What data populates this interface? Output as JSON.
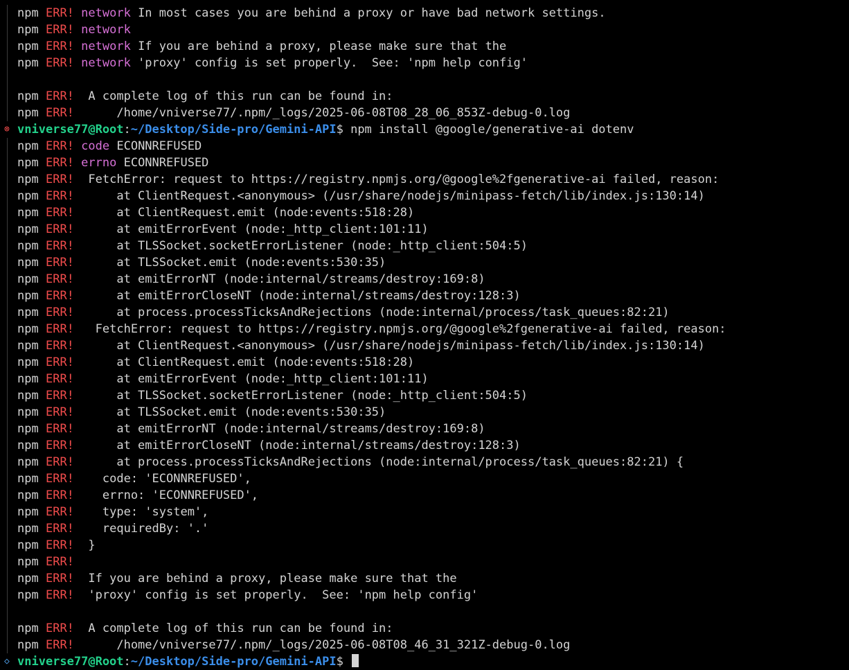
{
  "terminal": {
    "npm": "npm",
    "err": "ERR!",
    "prompt": {
      "user": "vniverse77@Root",
      "colon": ":",
      "path": "~/Desktop/Side-pro/Gemini-API",
      "symbol": "$ "
    },
    "lines": [
      {
        "type": "err",
        "kw": "network",
        "text": " In most cases you are behind a proxy or have bad network settings."
      },
      {
        "type": "err",
        "kw": "network",
        "text": ""
      },
      {
        "type": "err",
        "kw": "network",
        "text": " If you are behind a proxy, please make sure that the"
      },
      {
        "type": "err",
        "kw": "network",
        "text": " 'proxy' config is set properly.  See: 'npm help config'"
      },
      {
        "type": "blank"
      },
      {
        "type": "err",
        "text": " A complete log of this run can be found in:"
      },
      {
        "type": "err",
        "text": "     /home/vniverse77/.npm/_logs/2025-06-08T08_28_06_853Z-debug-0.log"
      },
      {
        "type": "prompt",
        "icon": "fail",
        "command": "npm install @google/generative-ai dotenv"
      },
      {
        "type": "err",
        "kw": "code",
        "text": " ECONNREFUSED"
      },
      {
        "type": "err",
        "kw": "errno",
        "text": " ECONNREFUSED"
      },
      {
        "type": "err",
        "text": " FetchError: request to https://registry.npmjs.org/@google%2fgenerative-ai failed, reason:"
      },
      {
        "type": "err",
        "text": "     at ClientRequest.<anonymous> (/usr/share/nodejs/minipass-fetch/lib/index.js:130:14)"
      },
      {
        "type": "err",
        "text": "     at ClientRequest.emit (node:events:518:28)"
      },
      {
        "type": "err",
        "text": "     at emitErrorEvent (node:_http_client:101:11)"
      },
      {
        "type": "err",
        "text": "     at TLSSocket.socketErrorListener (node:_http_client:504:5)"
      },
      {
        "type": "err",
        "text": "     at TLSSocket.emit (node:events:530:35)"
      },
      {
        "type": "err",
        "text": "     at emitErrorNT (node:internal/streams/destroy:169:8)"
      },
      {
        "type": "err",
        "text": "     at emitErrorCloseNT (node:internal/streams/destroy:128:3)"
      },
      {
        "type": "err",
        "text": "     at process.processTicksAndRejections (node:internal/process/task_queues:82:21)"
      },
      {
        "type": "err",
        "text": "  FetchError: request to https://registry.npmjs.org/@google%2fgenerative-ai failed, reason:"
      },
      {
        "type": "err",
        "text": "     at ClientRequest.<anonymous> (/usr/share/nodejs/minipass-fetch/lib/index.js:130:14)"
      },
      {
        "type": "err",
        "text": "     at ClientRequest.emit (node:events:518:28)"
      },
      {
        "type": "err",
        "text": "     at emitErrorEvent (node:_http_client:101:11)"
      },
      {
        "type": "err",
        "text": "     at TLSSocket.socketErrorListener (node:_http_client:504:5)"
      },
      {
        "type": "err",
        "text": "     at TLSSocket.emit (node:events:530:35)"
      },
      {
        "type": "err",
        "text": "     at emitErrorNT (node:internal/streams/destroy:169:8)"
      },
      {
        "type": "err",
        "text": "     at emitErrorCloseNT (node:internal/streams/destroy:128:3)"
      },
      {
        "type": "err",
        "text": "     at process.processTicksAndRejections (node:internal/process/task_queues:82:21) {"
      },
      {
        "type": "err",
        "text": "   code: 'ECONNREFUSED',"
      },
      {
        "type": "err",
        "text": "   errno: 'ECONNREFUSED',"
      },
      {
        "type": "err",
        "text": "   type: 'system',"
      },
      {
        "type": "err",
        "text": "   requiredBy: '.'"
      },
      {
        "type": "err",
        "text": " }"
      },
      {
        "type": "err",
        "text": ""
      },
      {
        "type": "err",
        "text": " If you are behind a proxy, please make sure that the"
      },
      {
        "type": "err",
        "text": " 'proxy' config is set properly.  See: 'npm help config'"
      },
      {
        "type": "blank"
      },
      {
        "type": "err",
        "text": " A complete log of this run can be found in:"
      },
      {
        "type": "err",
        "text": "     /home/vniverse77/.npm/_logs/2025-06-08T08_46_31_321Z-debug-0.log"
      },
      {
        "type": "prompt",
        "icon": "mark",
        "command": "",
        "cursor": true
      }
    ]
  },
  "icons": {
    "fail": "⊗",
    "mark": "◇"
  },
  "colors": {
    "background": "#000000",
    "foreground": "#d4d4d4",
    "error": "#f14c4c",
    "keyword": "#d670d6",
    "user": "#23d18b",
    "path": "#3b8eea"
  }
}
